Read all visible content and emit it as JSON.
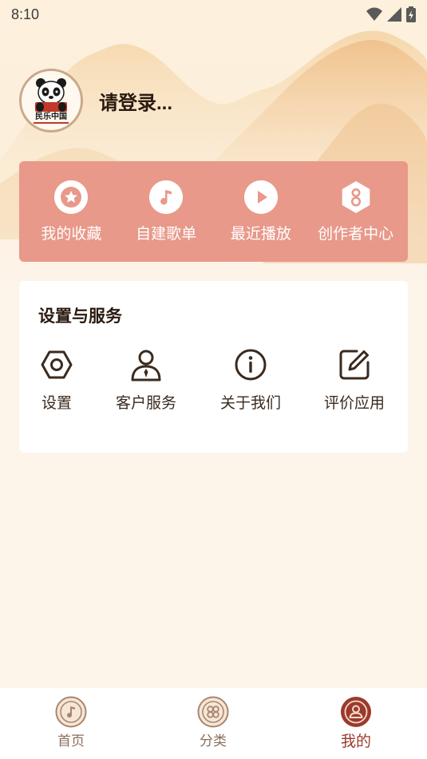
{
  "status_bar": {
    "time": "8:10"
  },
  "profile": {
    "login_prompt": "请登录...",
    "avatar_logo_text": "民乐中国"
  },
  "quick_actions": [
    {
      "label": "我的收藏",
      "icon": "star-icon"
    },
    {
      "label": "自建歌单",
      "icon": "music-note-icon"
    },
    {
      "label": "最近播放",
      "icon": "play-icon"
    },
    {
      "label": "创作者中心",
      "icon": "creator-icon"
    }
  ],
  "settings": {
    "title": "设置与服务",
    "items": [
      {
        "label": "设置",
        "icon": "gear-hexagon-icon"
      },
      {
        "label": "客户服务",
        "icon": "customer-service-icon"
      },
      {
        "label": "关于我们",
        "icon": "info-icon"
      },
      {
        "label": "评价应用",
        "icon": "edit-icon"
      }
    ]
  },
  "tabs": [
    {
      "label": "首页",
      "icon": "music-disc-icon",
      "active": false
    },
    {
      "label": "分类",
      "icon": "flower-grid-icon",
      "active": false
    },
    {
      "label": "我的",
      "icon": "user-icon",
      "active": true
    }
  ],
  "colors": {
    "accent_panel": "#e8998a",
    "active_tab": "#9b3a2c",
    "inactive_tab": "#8a6f5c",
    "icon_dark": "#3a2a1e"
  }
}
